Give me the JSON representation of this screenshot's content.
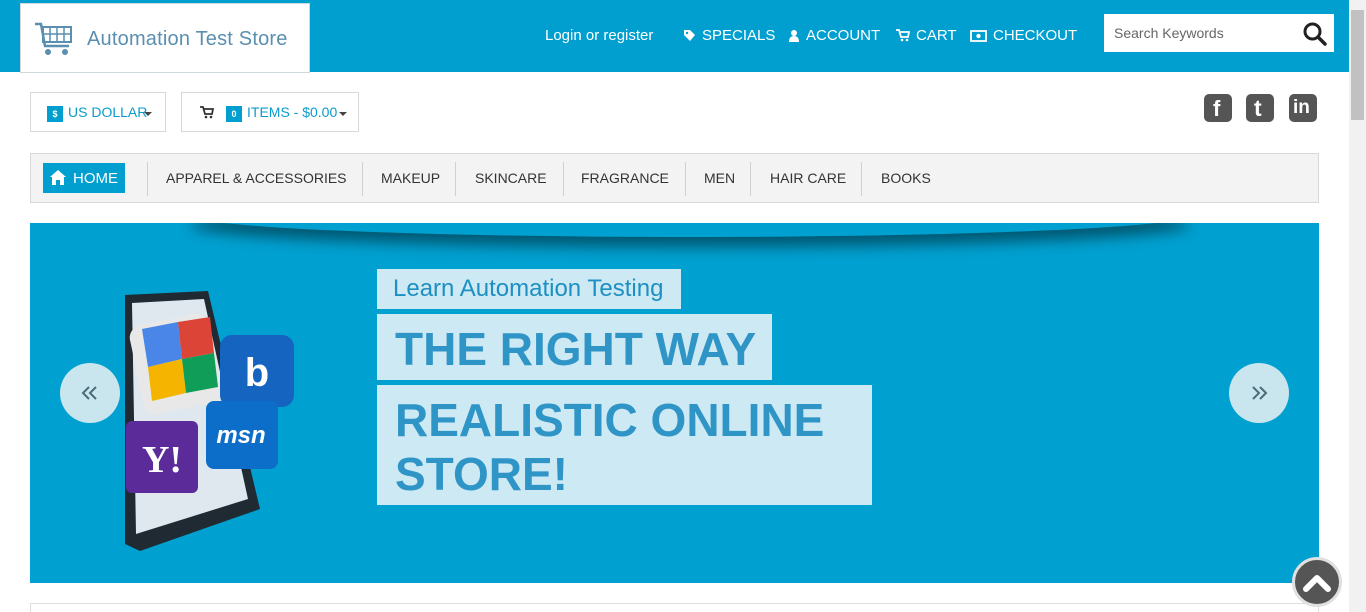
{
  "header": {
    "logo_text": "Automation Test Store",
    "login_link": "Login or register",
    "nav": [
      {
        "label": "SPECIALS",
        "icon": "tag-icon"
      },
      {
        "label": "ACCOUNT",
        "icon": "user-icon"
      },
      {
        "label": "CART",
        "icon": "cart-icon"
      },
      {
        "label": "CHECKOUT",
        "icon": "money-icon"
      }
    ],
    "search": {
      "placeholder": "Search Keywords",
      "value": ""
    }
  },
  "currency": {
    "symbol": "$",
    "label": "US DOLLAR"
  },
  "cart_summary": {
    "count": "0",
    "label": "ITEMS - $0.00"
  },
  "social": [
    {
      "name": "facebook-icon",
      "glyph": "f"
    },
    {
      "name": "twitter-icon",
      "glyph": "t"
    },
    {
      "name": "linkedin-icon",
      "glyph": "in"
    }
  ],
  "categories": {
    "home": "HOME",
    "items": [
      "APPAREL & ACCESSORIES",
      "MAKEUP",
      "SKINCARE",
      "FRAGRANCE",
      "MEN",
      "HAIR CARE",
      "BOOKS"
    ]
  },
  "banner": {
    "line1": "Learn Automation Testing",
    "line2": "THE RIGHT WAY",
    "line3": "REALISTIC ONLINE STORE!",
    "logos": [
      "b",
      "Y!",
      "msn"
    ]
  },
  "colors": {
    "accent": "#009fcf",
    "banner_text": "#2f95c7",
    "tag_bg": "#cde9f3"
  }
}
